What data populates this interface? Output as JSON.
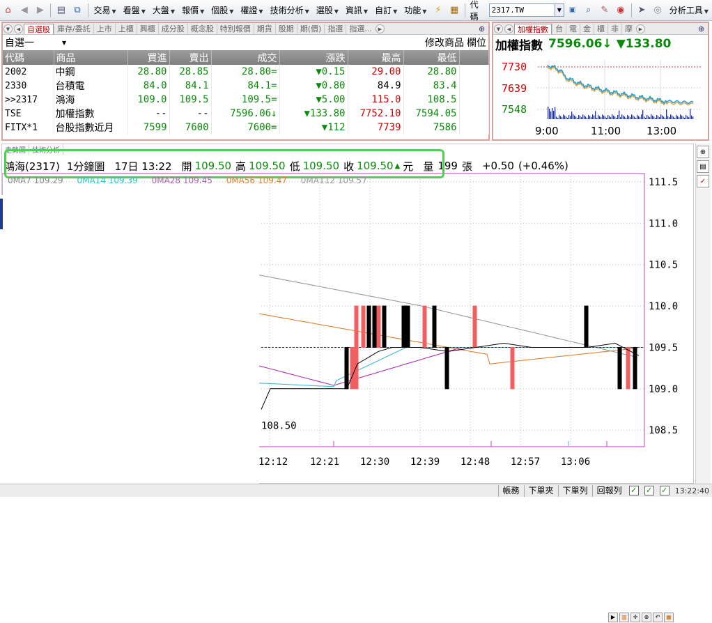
{
  "toolbar": {
    "menus": [
      "交易",
      "看盤",
      "大盤",
      "報價",
      "個股",
      "權證",
      "技術分析",
      "選股",
      "資訊",
      "自訂",
      "功能"
    ],
    "code_label": "代碼",
    "code_value": "2317.TW",
    "analysis_tools": "分析工具"
  },
  "watchlist": {
    "tabs": [
      "自選股",
      "庫存/委託",
      "上市",
      "上櫃",
      "興櫃",
      "成分股",
      "概念股",
      "特別報價",
      "期貨",
      "股期",
      "期(價)",
      "指選",
      "指選..."
    ],
    "list_name": "自選一",
    "edit_label": "修改商品",
    "field_label": "欄位",
    "columns": [
      "代碼",
      "商品",
      "買進",
      "賣出",
      "成交",
      "漲跌",
      "最高",
      "最低"
    ],
    "rows": [
      {
        "code": "2002",
        "name": "中鋼",
        "bid": "28.80",
        "ask": "28.85",
        "last": "28.80=",
        "change": "▼0.15",
        "high": "29.00",
        "low": "28.80"
      },
      {
        "code": "2330",
        "name": "台積電",
        "bid": "84.0",
        "ask": "84.1",
        "last": "84.1=",
        "change": "▼0.80",
        "high": "84.9",
        "low": "83.4"
      },
      {
        "code": ">>2317",
        "name": "鴻海",
        "bid": "109.0",
        "ask": "109.5",
        "last": "109.5=",
        "change": "▼5.00",
        "high": "115.0",
        "low": "108.5"
      },
      {
        "code": "TSE",
        "name": "加權指數",
        "bid": "--",
        "ask": "--",
        "last": "7596.06↓",
        "change": "▼133.80",
        "high": "7752.10",
        "low": "7594.05"
      },
      {
        "code": "FITX*1",
        "name": "台股指數近月",
        "bid": "7599",
        "ask": "7600",
        "last": "7600=",
        "change": "▼112",
        "high": "7739",
        "low": "7586"
      }
    ]
  },
  "index_panel": {
    "tabs": [
      "加權指數",
      "台",
      "電",
      "金",
      "櫃",
      "非",
      "摩"
    ],
    "title": "加權指數",
    "value": "7596.06↓",
    "change": "▼133.80",
    "y_labels": [
      "7730",
      "7639",
      "7548"
    ],
    "x_labels": [
      "9:00",
      "11:00",
      "13:00"
    ]
  },
  "chart_panel": {
    "tabs": [
      "走勢圖",
      "技術分析"
    ],
    "symbol": "鴻海(2317)",
    "period": "1分鐘圖",
    "datetime": "17日 13:22",
    "open_label": "開",
    "open": "109.50",
    "high_label": "高",
    "high": "109.50",
    "low_label": "低",
    "low": "109.50",
    "close_label": "收",
    "close": "109.50",
    "unit": "元",
    "volume_label": "量",
    "volume": "199",
    "volume_unit": "張",
    "change": "+0.50",
    "change_pct": "(+0.46%)",
    "ma": [
      "0MA7 109.29",
      "0MA14 109.39",
      "0MA28 109.45",
      "0MA56 109.47",
      "0MA112 109.57"
    ],
    "low_annotation": "108.50"
  },
  "chart_data": {
    "type": "line",
    "x_ticks": [
      "12:12",
      "12:21",
      "12:30",
      "12:39",
      "12:48",
      "12:57",
      "13:06"
    ],
    "y_ticks": [
      "111.5",
      "111.0",
      "110.5",
      "110.0",
      "109.5",
      "109.0",
      "108.5"
    ],
    "ylim": [
      108.3,
      111.6
    ],
    "grid": true
  },
  "status_bar": {
    "buttons": [
      "帳務",
      "下單夾",
      "下單列",
      "回報列"
    ],
    "time": "13:22:40"
  },
  "colors": {
    "up": "#d40000",
    "down": "#0a8a0a",
    "highlight_box": "#4dd24d",
    "frame": "#d8a1a1"
  }
}
